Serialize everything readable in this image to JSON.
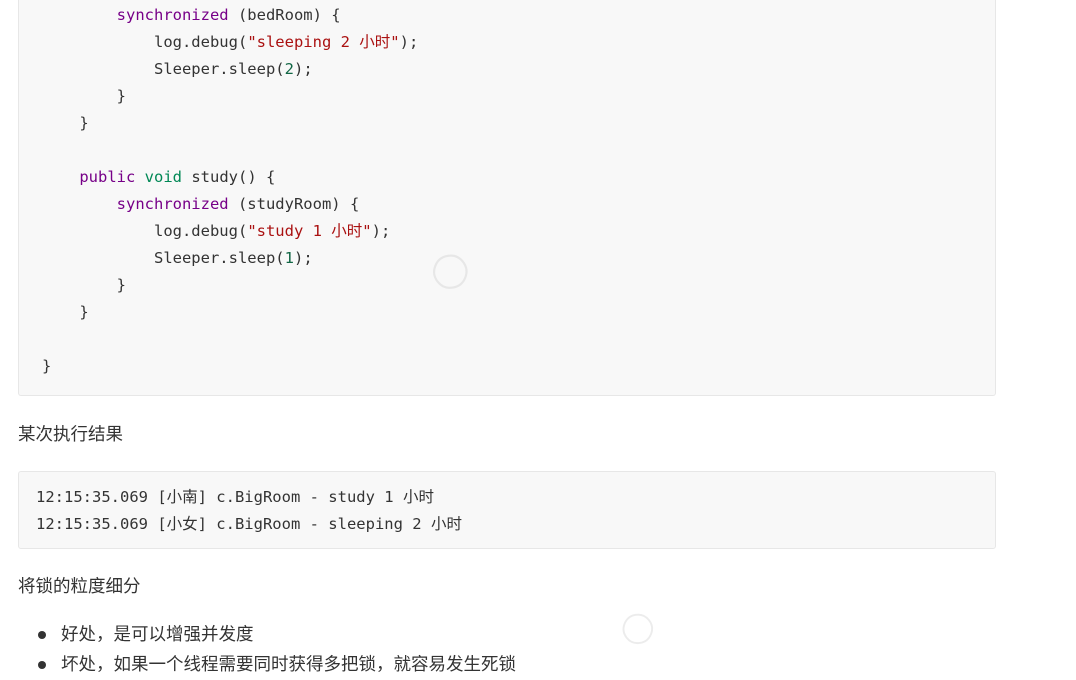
{
  "code_block": {
    "lines": [
      {
        "indent": "        ",
        "parts": [
          {
            "text": "synchronized",
            "style": "kw-purple"
          },
          {
            "text": " (bedRoom) {",
            "style": ""
          }
        ]
      },
      {
        "indent": "            ",
        "parts": [
          {
            "text": "log.debug(",
            "style": ""
          },
          {
            "text": "\"sleeping 2 小时\"",
            "style": "str"
          },
          {
            "text": ");",
            "style": ""
          }
        ]
      },
      {
        "indent": "            ",
        "parts": [
          {
            "text": "Sleeper.sleep(",
            "style": ""
          },
          {
            "text": "2",
            "style": "num"
          },
          {
            "text": ");",
            "style": ""
          }
        ]
      },
      {
        "indent": "        ",
        "parts": [
          {
            "text": "}",
            "style": ""
          }
        ]
      },
      {
        "indent": "    ",
        "parts": [
          {
            "text": "}",
            "style": ""
          }
        ]
      },
      {
        "indent": "",
        "parts": []
      },
      {
        "indent": "    ",
        "parts": [
          {
            "text": "public",
            "style": "kw-purple"
          },
          {
            "text": " ",
            "style": ""
          },
          {
            "text": "void",
            "style": "kw-green"
          },
          {
            "text": " study() {",
            "style": ""
          }
        ]
      },
      {
        "indent": "        ",
        "parts": [
          {
            "text": "synchronized",
            "style": "kw-purple"
          },
          {
            "text": " (studyRoom) {",
            "style": ""
          }
        ]
      },
      {
        "indent": "            ",
        "parts": [
          {
            "text": "log.debug(",
            "style": ""
          },
          {
            "text": "\"study 1 小时\"",
            "style": "str"
          },
          {
            "text": ");",
            "style": ""
          }
        ]
      },
      {
        "indent": "            ",
        "parts": [
          {
            "text": "Sleeper.sleep(",
            "style": ""
          },
          {
            "text": "1",
            "style": "num"
          },
          {
            "text": ");",
            "style": ""
          }
        ]
      },
      {
        "indent": "        ",
        "parts": [
          {
            "text": "}",
            "style": ""
          }
        ]
      },
      {
        "indent": "    ",
        "parts": [
          {
            "text": "}",
            "style": ""
          }
        ]
      },
      {
        "indent": "",
        "parts": []
      },
      {
        "indent": "",
        "parts": [
          {
            "text": "}",
            "style": ""
          }
        ]
      }
    ]
  },
  "result_heading": "某次执行结果",
  "result_block": {
    "lines": [
      "12:15:35.069 [小南] c.BigRoom - study 1 小时",
      "12:15:35.069 [小女] c.BigRoom - sleeping 2 小时"
    ]
  },
  "granularity_heading": "将锁的粒度细分",
  "bullets": [
    "好处，是可以增强并发度",
    "坏处，如果一个线程需要同时获得多把锁，就容易发生死锁"
  ]
}
